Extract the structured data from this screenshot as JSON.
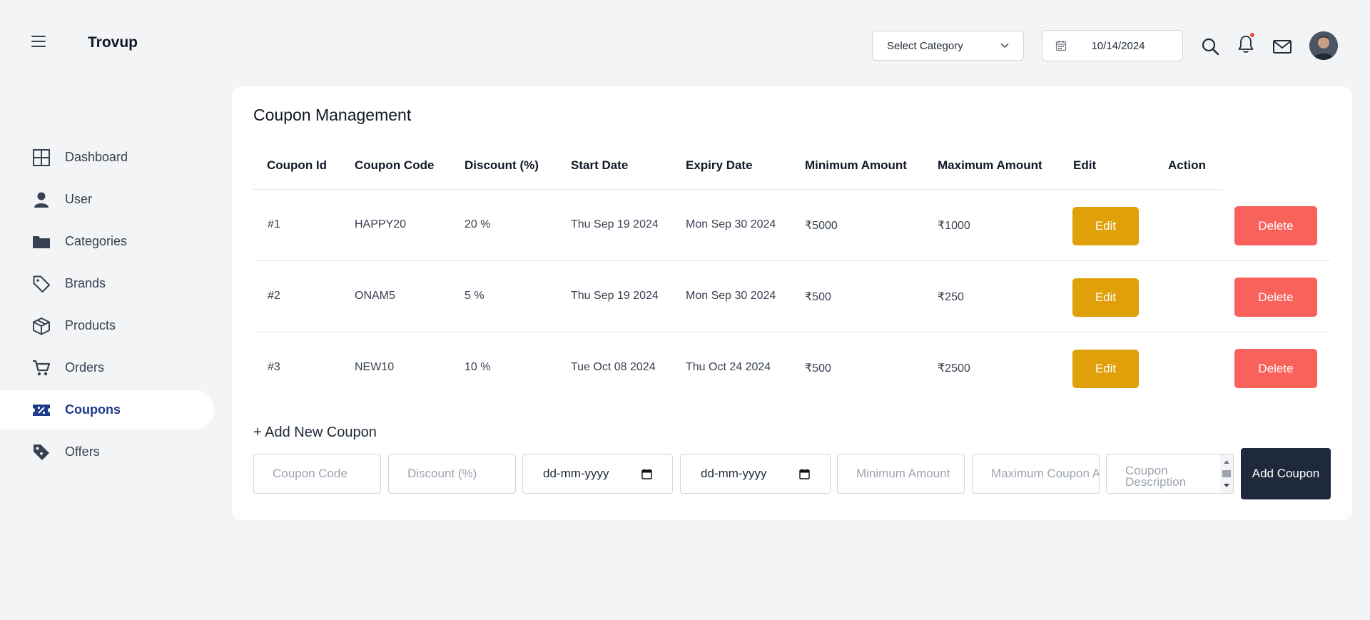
{
  "header": {
    "brand": "Trovup",
    "category_select": "Select Category",
    "date": "10/14/2024"
  },
  "sidebar": {
    "items": [
      {
        "label": "Dashboard",
        "icon": "grid-icon",
        "active": false
      },
      {
        "label": "User",
        "icon": "user-icon",
        "active": false
      },
      {
        "label": "Categories",
        "icon": "folder-icon",
        "active": false
      },
      {
        "label": "Brands",
        "icon": "tag-icon",
        "active": false
      },
      {
        "label": "Products",
        "icon": "box-icon",
        "active": false
      },
      {
        "label": "Orders",
        "icon": "cart-icon",
        "active": false
      },
      {
        "label": "Coupons",
        "icon": "coupon-icon",
        "active": true
      },
      {
        "label": "Offers",
        "icon": "offer-tag-icon",
        "active": false
      }
    ]
  },
  "main": {
    "title": "Coupon Management",
    "columns": [
      "Coupon Id",
      "Coupon Code",
      "Discount (%)",
      "Start Date",
      "Expiry Date",
      "Minimum Amount",
      "Maximum Amount",
      "Edit",
      "Action"
    ],
    "rows": [
      {
        "id": "#1",
        "code": "HAPPY20",
        "discount": "20 %",
        "start": "Thu Sep 19 2024",
        "expiry": "Mon Sep 30 2024",
        "min": "₹5000",
        "max": "₹1000",
        "edit": "Edit",
        "action": "Delete"
      },
      {
        "id": "#2",
        "code": "ONAM5",
        "discount": "5 %",
        "start": "Thu Sep 19 2024",
        "expiry": "Mon Sep 30 2024",
        "min": "₹500",
        "max": "₹250",
        "edit": "Edit",
        "action": "Delete"
      },
      {
        "id": "#3",
        "code": "NEW10",
        "discount": "10 %",
        "start": "Tue Oct 08 2024",
        "expiry": "Thu Oct 24 2024",
        "min": "₹500",
        "max": "₹2500",
        "edit": "Edit",
        "action": "Delete"
      }
    ],
    "add_title": "+ Add New Coupon",
    "form": {
      "coupon_code": "Coupon Code",
      "discount": "Discount (%)",
      "start_date": "dd-mm-yyyy",
      "expiry_date": "dd-mm-yyyy",
      "minimum": "Minimum Amount",
      "maximum": "Maximum Coupon Amount",
      "description": "Coupon Description",
      "submit": "Add Coupon"
    }
  },
  "colors": {
    "edit": "#e0a009",
    "delete": "#f8625a",
    "add": "#1e293b",
    "active_nav": "#1e3a8a"
  }
}
